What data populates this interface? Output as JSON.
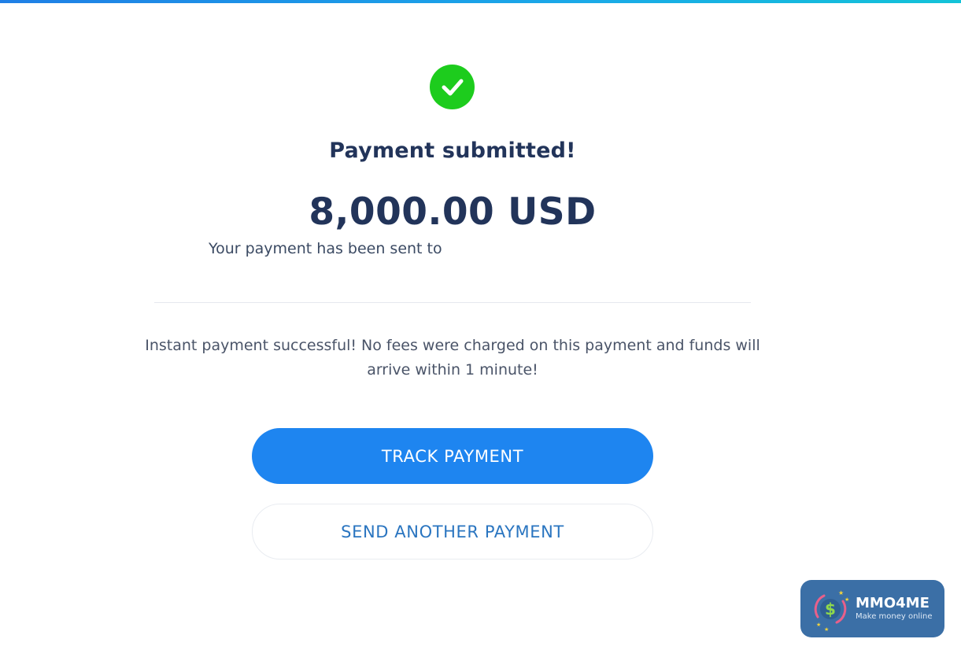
{
  "confirmation": {
    "title": "Payment submitted!",
    "amount": "8,000.00 USD",
    "recipient_prefix": "Your payment has been sent to",
    "note": "Instant payment successful! No fees were charged on this payment and funds will arrive within 1 minute!"
  },
  "actions": {
    "track_label": "TRACK PAYMENT",
    "send_another_label": "SEND ANOTHER PAYMENT"
  },
  "watermark": {
    "name": "MMO4ME",
    "tagline": "Make money online"
  },
  "icons": {
    "status": "check-circle-icon",
    "logo": "dollar-coin-icon"
  },
  "colors": {
    "success": "#1dcc1d",
    "primary": "#1e85f0",
    "heading": "#22345a",
    "watermark_bg": "#3b6fa6"
  }
}
